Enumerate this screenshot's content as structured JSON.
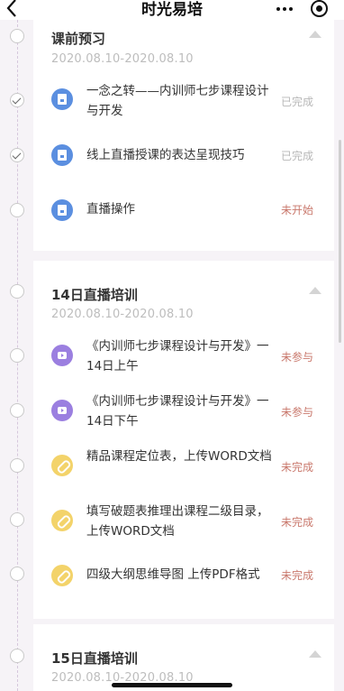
{
  "app": {
    "title": "时光易培"
  },
  "sections": [
    {
      "title": "课前预习",
      "date": "2020.08.10-2020.08.10",
      "items": [
        {
          "icon": "book-icon",
          "label": "一念之转——内训师七步课程设计与开发",
          "status": "已完成",
          "status_color": "#b7b7b7",
          "done": true
        },
        {
          "icon": "book-icon",
          "label": "线上直播授课的表达呈现技巧",
          "status": "已完成",
          "status_color": "#b7b7b7",
          "done": true
        },
        {
          "icon": "book-icon",
          "label": "直播操作",
          "status": "未开始",
          "status_color": "#c9786c",
          "done": false
        }
      ]
    },
    {
      "title": "14日直播培训",
      "date": "2020.08.10-2020.08.10",
      "items": [
        {
          "icon": "live-icon",
          "label": "《内训师七步课程设计与开发》一14日上午",
          "status": "未参与",
          "status_color": "#c9786c",
          "done": false
        },
        {
          "icon": "live-icon",
          "label": "《内训师七步课程设计与开发》一14日下午",
          "status": "未参与",
          "status_color": "#c9786c",
          "done": false
        },
        {
          "icon": "paperclip-icon",
          "label": "精品课程定位表，上传WORD文档",
          "status": "未完成",
          "status_color": "#c9786c",
          "done": false
        },
        {
          "icon": "paperclip-icon",
          "label": "填写破题表推理出课程二级目录，上传WORD文档",
          "status": "未完成",
          "status_color": "#c9786c",
          "done": false
        },
        {
          "icon": "paperclip-icon",
          "label": "四级大纲思维导图 上传PDF格式",
          "status": "未完成",
          "status_color": "#c9786c",
          "done": false
        }
      ]
    },
    {
      "title": "15日直播培训",
      "date": "2020.08.10-2020.08.10",
      "items": []
    }
  ]
}
